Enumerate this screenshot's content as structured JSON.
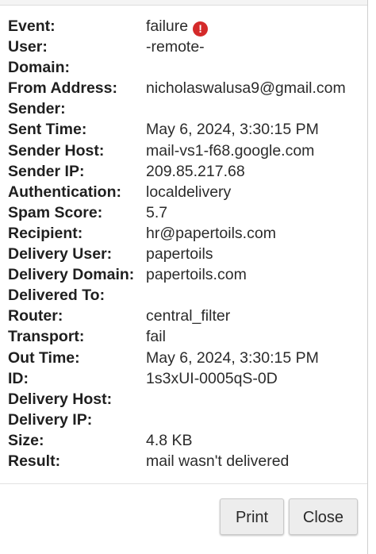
{
  "fields": [
    {
      "label": "Event:",
      "value": "failure"
    },
    {
      "label": "User:",
      "value": "-remote-"
    },
    {
      "label": "Domain:",
      "value": ""
    },
    {
      "label": "From Address:",
      "value": "nicholaswalusa9@gmail.com"
    },
    {
      "label": "Sender:",
      "value": ""
    },
    {
      "label": "Sent Time:",
      "value": "May 6, 2024, 3:30:15 PM"
    },
    {
      "label": "Sender Host:",
      "value": "mail-vs1-f68.google.com"
    },
    {
      "label": "Sender IP:",
      "value": "209.85.217.68"
    },
    {
      "label": "Authentication:",
      "value": "localdelivery"
    },
    {
      "label": "Spam Score:",
      "value": "5.7"
    },
    {
      "label": "Recipient:",
      "value": "hr@papertoils.com"
    },
    {
      "label": "Delivery User:",
      "value": "papertoils"
    },
    {
      "label": "Delivery Domain:",
      "value": "papertoils.com"
    },
    {
      "label": "Delivered To:",
      "value": ""
    },
    {
      "label": "Router:",
      "value": "central_filter"
    },
    {
      "label": "Transport:",
      "value": "fail"
    },
    {
      "label": "Out Time:",
      "value": "May 6, 2024, 3:30:15 PM"
    },
    {
      "label": "ID:",
      "value": "1s3xUI-0005qS-0D"
    },
    {
      "label": "Delivery Host:",
      "value": ""
    },
    {
      "label": "Delivery IP:",
      "value": ""
    },
    {
      "label": "Size:",
      "value": "4.8 KB"
    },
    {
      "label": "Result:",
      "value": "mail wasn't delivered"
    }
  ],
  "event_status_icon": {
    "name": "error-icon",
    "glyph": "!",
    "color": "#d42a2a"
  },
  "buttons": {
    "print_label": "Print",
    "close_label": "Close"
  }
}
